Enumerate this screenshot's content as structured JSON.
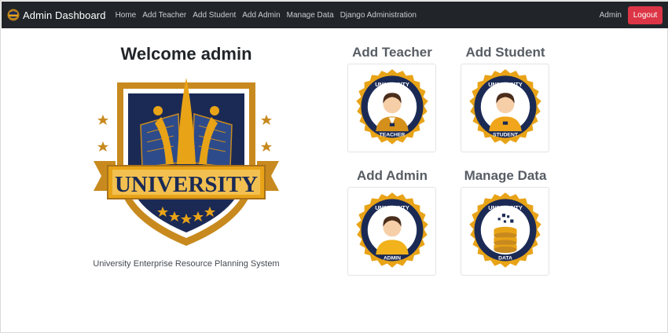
{
  "navbar": {
    "brand": "Admin Dashboard",
    "brand_icon": "university-logo-icon",
    "links": [
      "Home",
      "Add Teacher",
      "Add Student",
      "Add Admin",
      "Manage Data",
      "Django Administration"
    ],
    "user": "Admin",
    "logout_label": "Logout",
    "colors": {
      "bar": "#212529",
      "logout": "#dc3545"
    }
  },
  "main": {
    "welcome": "Welcome admin",
    "emblem_text": "UNIVERSITY",
    "subtitle": "University Enterprise Resource Planning System"
  },
  "cards": [
    {
      "title": "Add Teacher",
      "badge_top": "UNIVERSITY",
      "badge_bottom": "TEACHER",
      "icon": "teacher-icon"
    },
    {
      "title": "Add Student",
      "badge_top": "UNIVERSITY",
      "badge_bottom": "STUDENT",
      "icon": "student-icon"
    },
    {
      "title": "Add Admin",
      "badge_top": "UNIVERSITY",
      "badge_bottom": "ADMIN",
      "icon": "admin-icon"
    },
    {
      "title": "Manage Data",
      "badge_top": "UNIVERSITY",
      "badge_bottom": "DATA",
      "icon": "database-icon"
    }
  ],
  "colors": {
    "navy": "#1b2a55",
    "gold": "#e8a317",
    "dark_gold": "#b9801d"
  }
}
